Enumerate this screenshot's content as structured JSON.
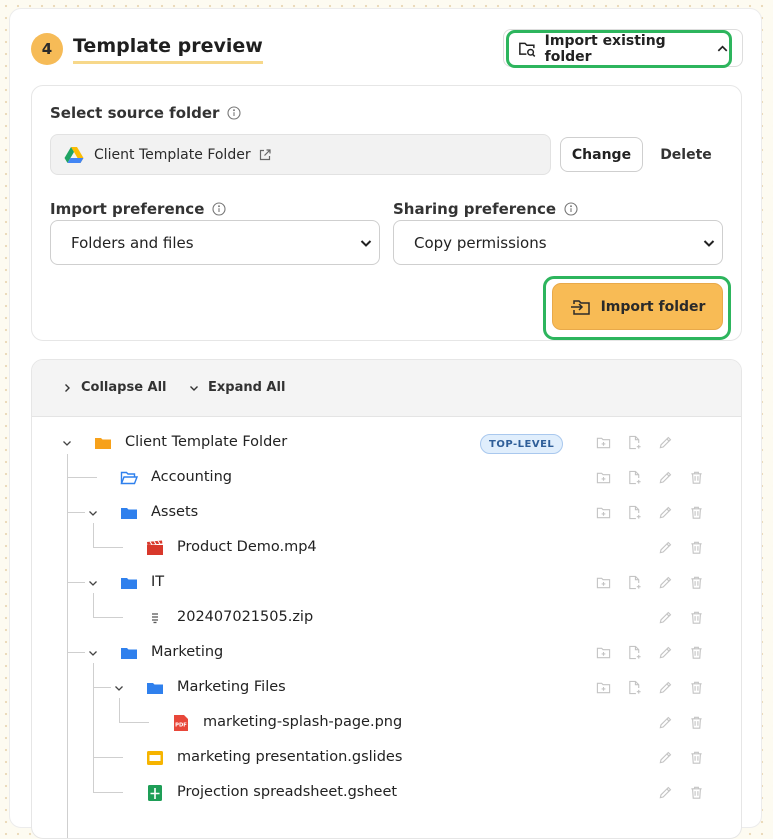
{
  "header": {
    "step_number": "4",
    "title": "Template preview",
    "import_existing_label": "Import existing folder"
  },
  "source": {
    "label": "Select source folder",
    "folder_name": "Client Template Folder",
    "change_label": "Change",
    "delete_label": "Delete"
  },
  "preferences": {
    "import_label": "Import preference",
    "import_value": "Folders and files",
    "sharing_label": "Sharing preference",
    "sharing_value": "Copy permissions"
  },
  "import_button_label": "Import folder",
  "tree_toolbar": {
    "collapse_label": "Collapse All",
    "expand_label": "Expand All"
  },
  "tree": {
    "badge": "TOP-LEVEL",
    "items": [
      {
        "name": "Client Template Folder",
        "icon": "folder-orange-icon"
      },
      {
        "name": "Accounting",
        "icon": "folder-open-outline-icon"
      },
      {
        "name": "Assets",
        "icon": "folder-blue-icon"
      },
      {
        "name": "Product Demo.mp4",
        "icon": "video-file-icon"
      },
      {
        "name": "IT",
        "icon": "folder-blue-icon"
      },
      {
        "name": "202407021505.zip",
        "icon": "zip-file-icon"
      },
      {
        "name": "Marketing",
        "icon": "folder-blue-icon"
      },
      {
        "name": "Marketing Files",
        "icon": "folder-blue-icon"
      },
      {
        "name": "marketing-splash-page.png",
        "icon": "pdf-file-icon",
        "icon_text": "PDF"
      },
      {
        "name": "marketing presentation.gslides",
        "icon": "google-slides-icon"
      },
      {
        "name": "Projection spreadsheet.gsheet",
        "icon": "google-sheets-icon"
      }
    ]
  },
  "colors": {
    "accent": "#f8bb55",
    "highlight_ring": "#2db55d",
    "folder_blue": "#2f80ed",
    "folder_orange": "#f7a11a"
  }
}
